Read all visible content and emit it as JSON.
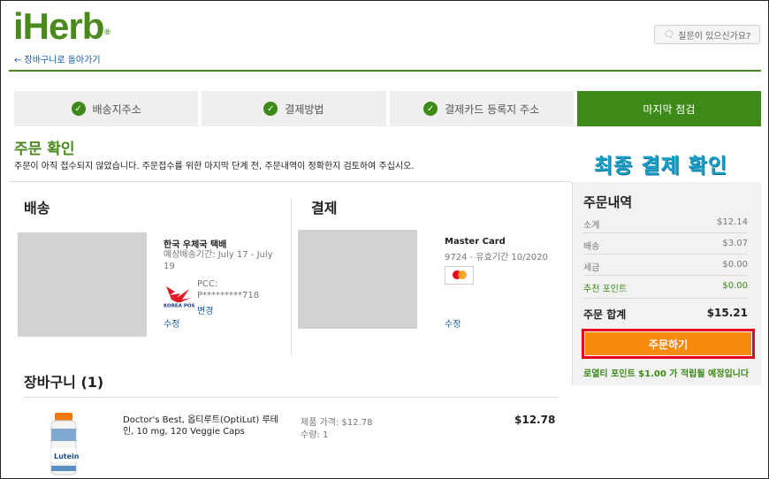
{
  "header": {
    "logo": "iHerb",
    "logo_mark": "®",
    "back_link": "← 장바구니로 돌아가기",
    "help_button": "질문이 있으신가요?"
  },
  "steps": [
    {
      "label": "배송지주소",
      "done": true
    },
    {
      "label": "결제방법",
      "done": true
    },
    {
      "label": "결제카드 등록지 주소",
      "done": true
    },
    {
      "label": "마지막 점검",
      "active": true
    }
  ],
  "page": {
    "title": "주문 확인",
    "subtitle": "주문이 아직 접수되지 않았습니다. 주문접수를 위한 마지막 단계 전, 주문내역이 정확한지 검토하여 주십시오.",
    "overlay_title": "최종 결제 확인"
  },
  "shipping": {
    "title": "배송",
    "carrier": "한국 우체국 택배",
    "eta": "예상배송기간: July 17 - July 19",
    "pcc_label": "PCC:",
    "pcc_value": "P*********718",
    "change_label": "변경",
    "edit_label": "수정"
  },
  "payment": {
    "title": "결제",
    "card_name": "Master Card",
    "card_detail": "9724 - 유효기간 10/2020",
    "edit_label": "수정"
  },
  "summary": {
    "title": "주문내역",
    "rows": [
      {
        "label": "소계",
        "value": "$12.14"
      },
      {
        "label": "배송",
        "value": "$3.07"
      },
      {
        "label": "세금",
        "value": "$0.00"
      },
      {
        "label": "추천 포인트",
        "value": "$0.00"
      }
    ],
    "total_label": "주문 합계",
    "total_value": "$15.21",
    "order_button": "주문하기",
    "points_note": "로열티 포인트 $1.00 가 적립될 예정입니다"
  },
  "cart": {
    "title": "장바구니 (1)",
    "items": [
      {
        "name": "Doctor's Best, 옵티루트(OptiLut) 루테인, 10 mg, 120 Veggie Caps",
        "price": "제품 가격: $12.78",
        "qty": "수량: 1",
        "total": "$12.78",
        "bottle_label": "Lutein"
      }
    ]
  },
  "colors": {
    "brand_green": "#3d8a18",
    "order_orange": "#f68a0e",
    "highlight_red": "#e8001c",
    "link_blue": "#1a5ba6"
  }
}
